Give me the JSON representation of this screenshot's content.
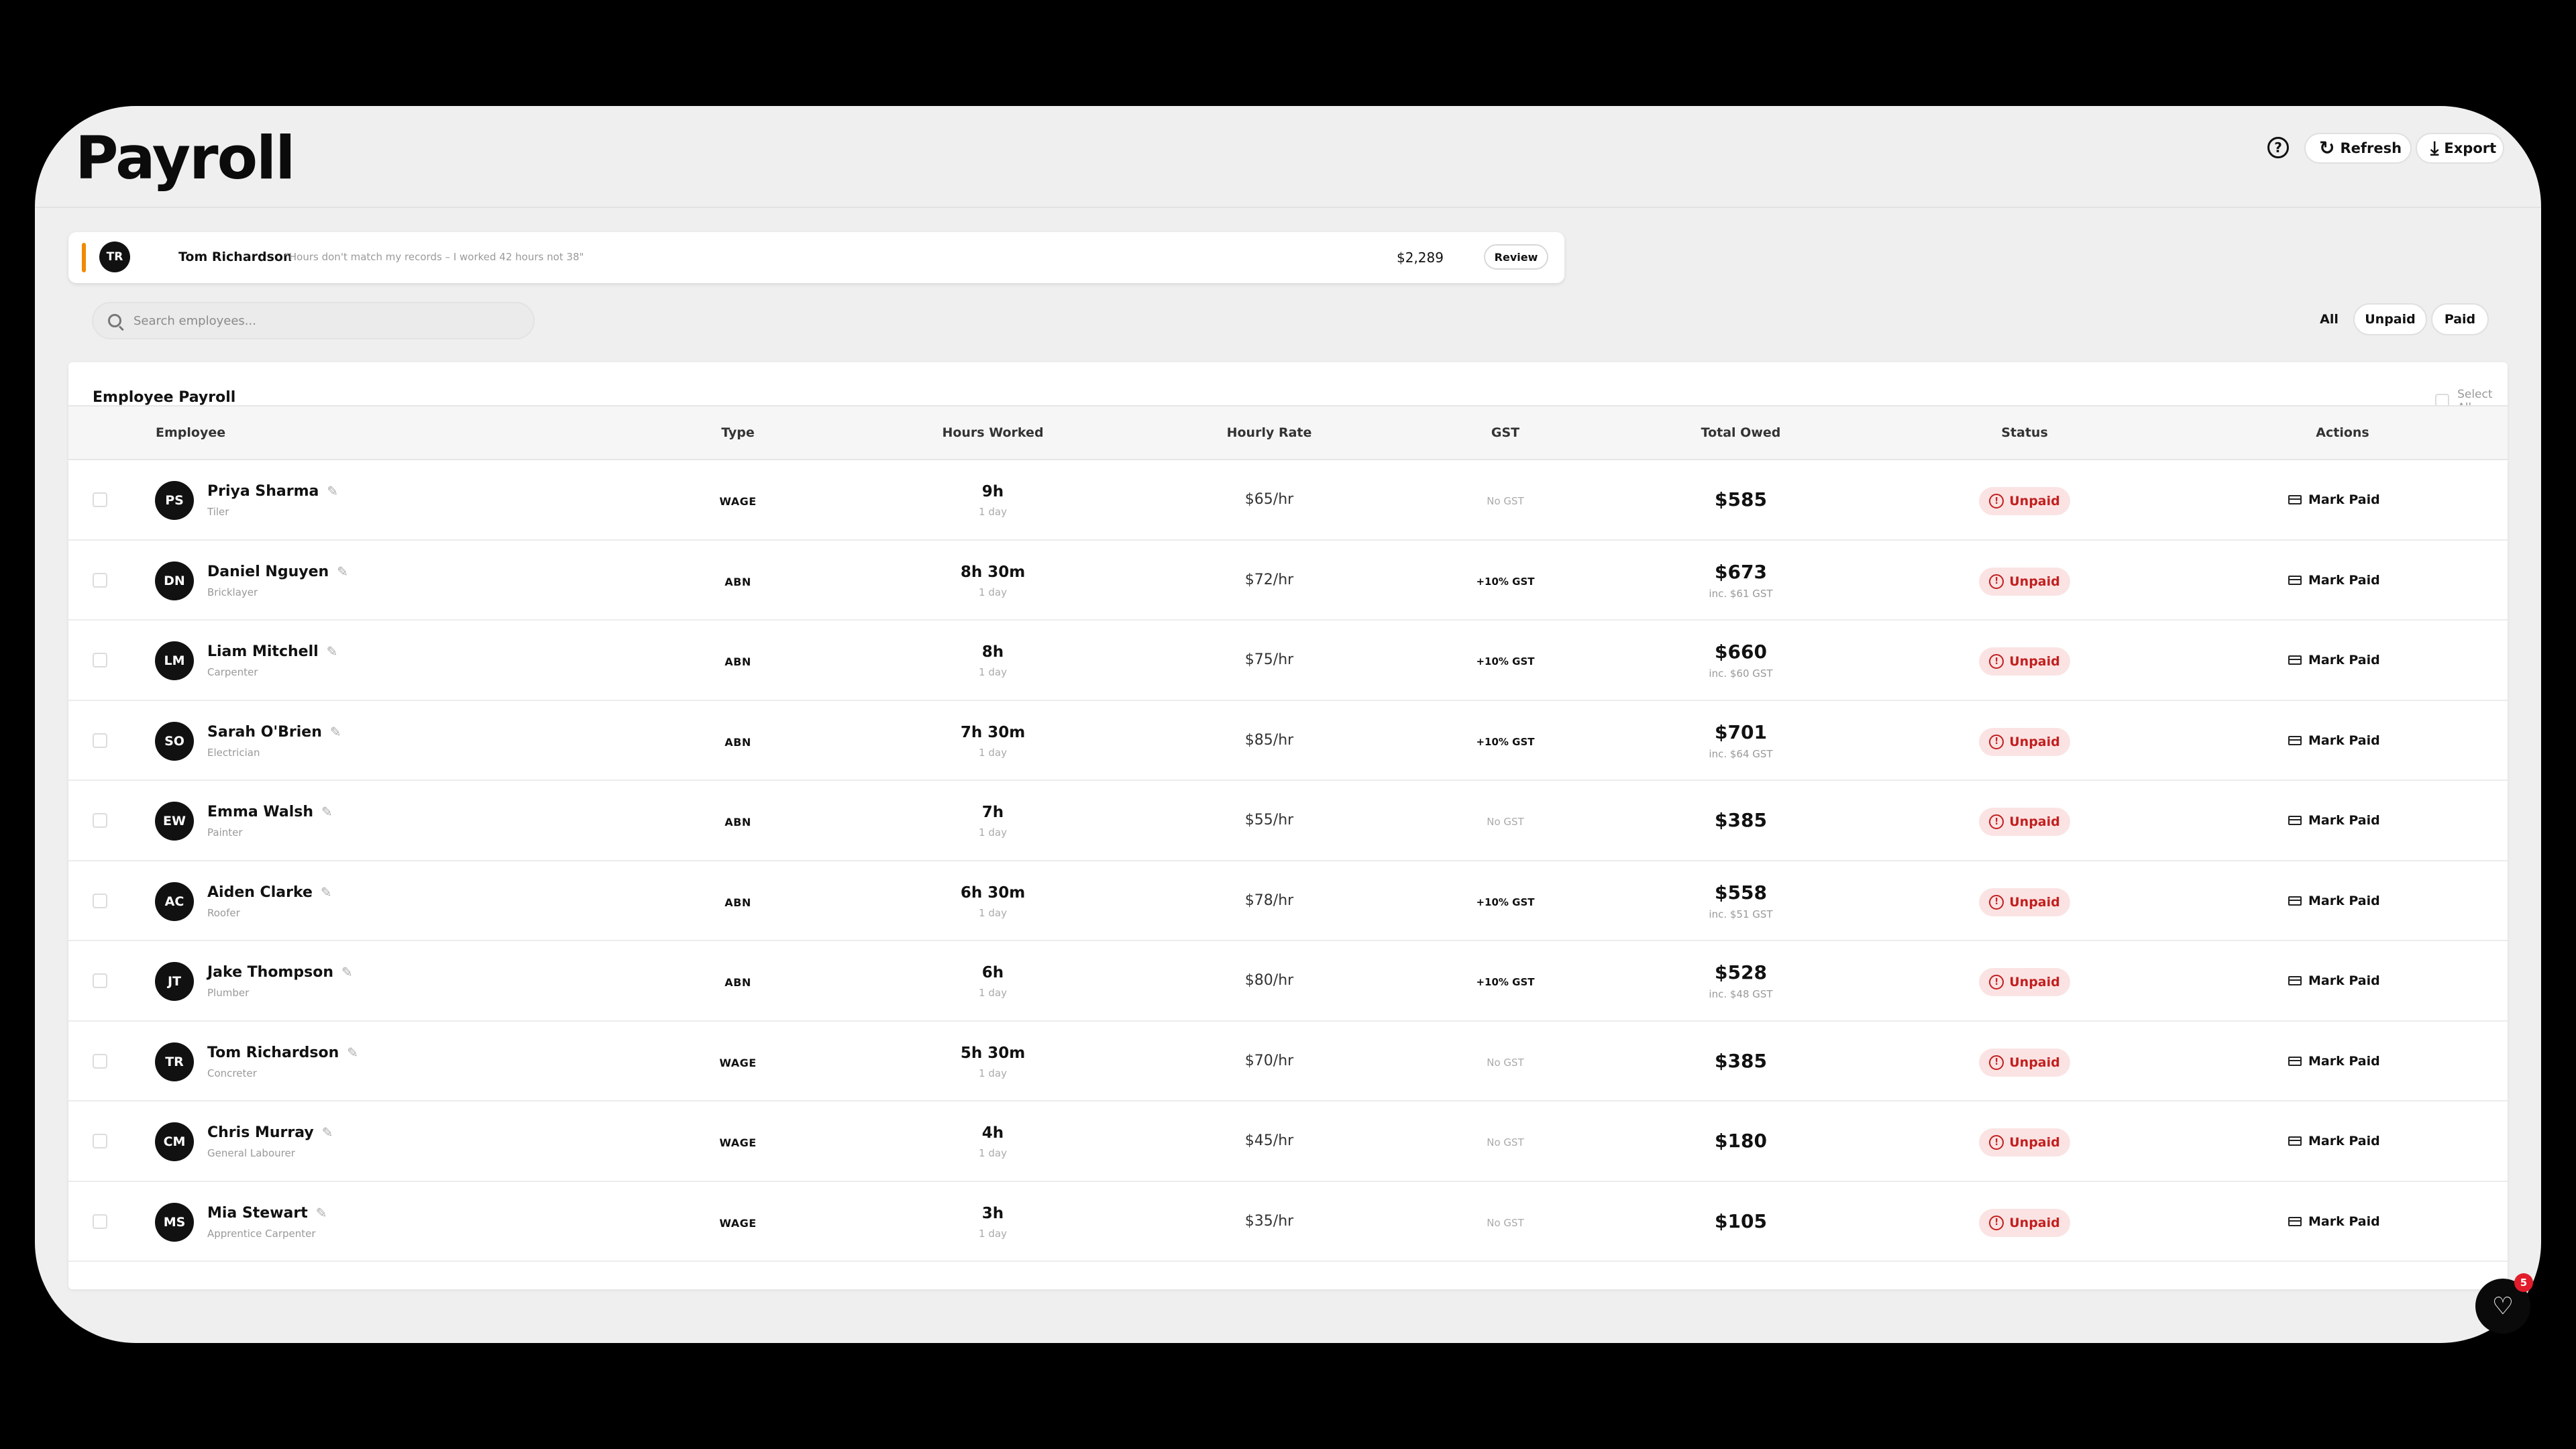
{
  "header": {
    "title": "Payroll",
    "help_glyph": "?",
    "refresh_label": "Refresh",
    "export_label": "Export"
  },
  "alert": {
    "initials": "TR",
    "name": "Tom Richardson",
    "message": "\"Hours don't match my records – I worked 42 hours not 38\"",
    "amount": "$2,289",
    "review_label": "Review",
    "accent_color": "#f08a00"
  },
  "search": {
    "placeholder": "Search employees..."
  },
  "filters": {
    "all": "All",
    "unpaid": "Unpaid",
    "paid": "Paid"
  },
  "table": {
    "title": "Employee Payroll",
    "select_all_label": "Select All",
    "columns": {
      "employee": "Employee",
      "type": "Type",
      "hours": "Hours Worked",
      "rate": "Hourly Rate",
      "gst": "GST",
      "total": "Total Owed",
      "status": "Status",
      "actions": "Actions"
    },
    "rows": [
      {
        "initials": "PS",
        "name": "Priya Sharma",
        "role": "Tiler",
        "type": "WAGE",
        "hours": "9h",
        "days": "1 day",
        "rate": "$65/hr",
        "gst": "No GST",
        "total": "$585",
        "inc_gst": "",
        "status": "Unpaid",
        "action": "Mark Paid"
      },
      {
        "initials": "DN",
        "name": "Daniel Nguyen",
        "role": "Bricklayer",
        "type": "ABN",
        "hours": "8h 30m",
        "days": "1 day",
        "rate": "$72/hr",
        "gst": "+10% GST",
        "total": "$673",
        "inc_gst": "inc. $61 GST",
        "status": "Unpaid",
        "action": "Mark Paid"
      },
      {
        "initials": "LM",
        "name": "Liam Mitchell",
        "role": "Carpenter",
        "type": "ABN",
        "hours": "8h",
        "days": "1 day",
        "rate": "$75/hr",
        "gst": "+10% GST",
        "total": "$660",
        "inc_gst": "inc. $60 GST",
        "status": "Unpaid",
        "action": "Mark Paid"
      },
      {
        "initials": "SO",
        "name": "Sarah O'Brien",
        "role": "Electrician",
        "type": "ABN",
        "hours": "7h 30m",
        "days": "1 day",
        "rate": "$85/hr",
        "gst": "+10% GST",
        "total": "$701",
        "inc_gst": "inc. $64 GST",
        "status": "Unpaid",
        "action": "Mark Paid"
      },
      {
        "initials": "EW",
        "name": "Emma Walsh",
        "role": "Painter",
        "type": "ABN",
        "hours": "7h",
        "days": "1 day",
        "rate": "$55/hr",
        "gst": "No GST",
        "total": "$385",
        "inc_gst": "",
        "status": "Unpaid",
        "action": "Mark Paid"
      },
      {
        "initials": "AC",
        "name": "Aiden Clarke",
        "role": "Roofer",
        "type": "ABN",
        "hours": "6h 30m",
        "days": "1 day",
        "rate": "$78/hr",
        "gst": "+10% GST",
        "total": "$558",
        "inc_gst": "inc. $51 GST",
        "status": "Unpaid",
        "action": "Mark Paid"
      },
      {
        "initials": "JT",
        "name": "Jake Thompson",
        "role": "Plumber",
        "type": "ABN",
        "hours": "6h",
        "days": "1 day",
        "rate": "$80/hr",
        "gst": "+10% GST",
        "total": "$528",
        "inc_gst": "inc. $48 GST",
        "status": "Unpaid",
        "action": "Mark Paid"
      },
      {
        "initials": "TR",
        "name": "Tom Richardson",
        "role": "Concreter",
        "type": "WAGE",
        "hours": "5h 30m",
        "days": "1 day",
        "rate": "$70/hr",
        "gst": "No GST",
        "total": "$385",
        "inc_gst": "",
        "status": "Unpaid",
        "action": "Mark Paid"
      },
      {
        "initials": "CM",
        "name": "Chris Murray",
        "role": "General Labourer",
        "type": "WAGE",
        "hours": "4h",
        "days": "1 day",
        "rate": "$45/hr",
        "gst": "No GST",
        "total": "$180",
        "inc_gst": "",
        "status": "Unpaid",
        "action": "Mark Paid"
      },
      {
        "initials": "MS",
        "name": "Mia Stewart",
        "role": "Apprentice Carpenter",
        "type": "WAGE",
        "hours": "3h",
        "days": "1 day",
        "rate": "$35/hr",
        "gst": "No GST",
        "total": "$105",
        "inc_gst": "",
        "status": "Unpaid",
        "action": "Mark Paid"
      }
    ]
  },
  "fab": {
    "icon": "heart-icon",
    "badge": "5"
  },
  "colors": {
    "unpaid_text": "#c21f1f",
    "unpaid_bg": "#fbe3e3",
    "badge": "#e21c2b"
  }
}
